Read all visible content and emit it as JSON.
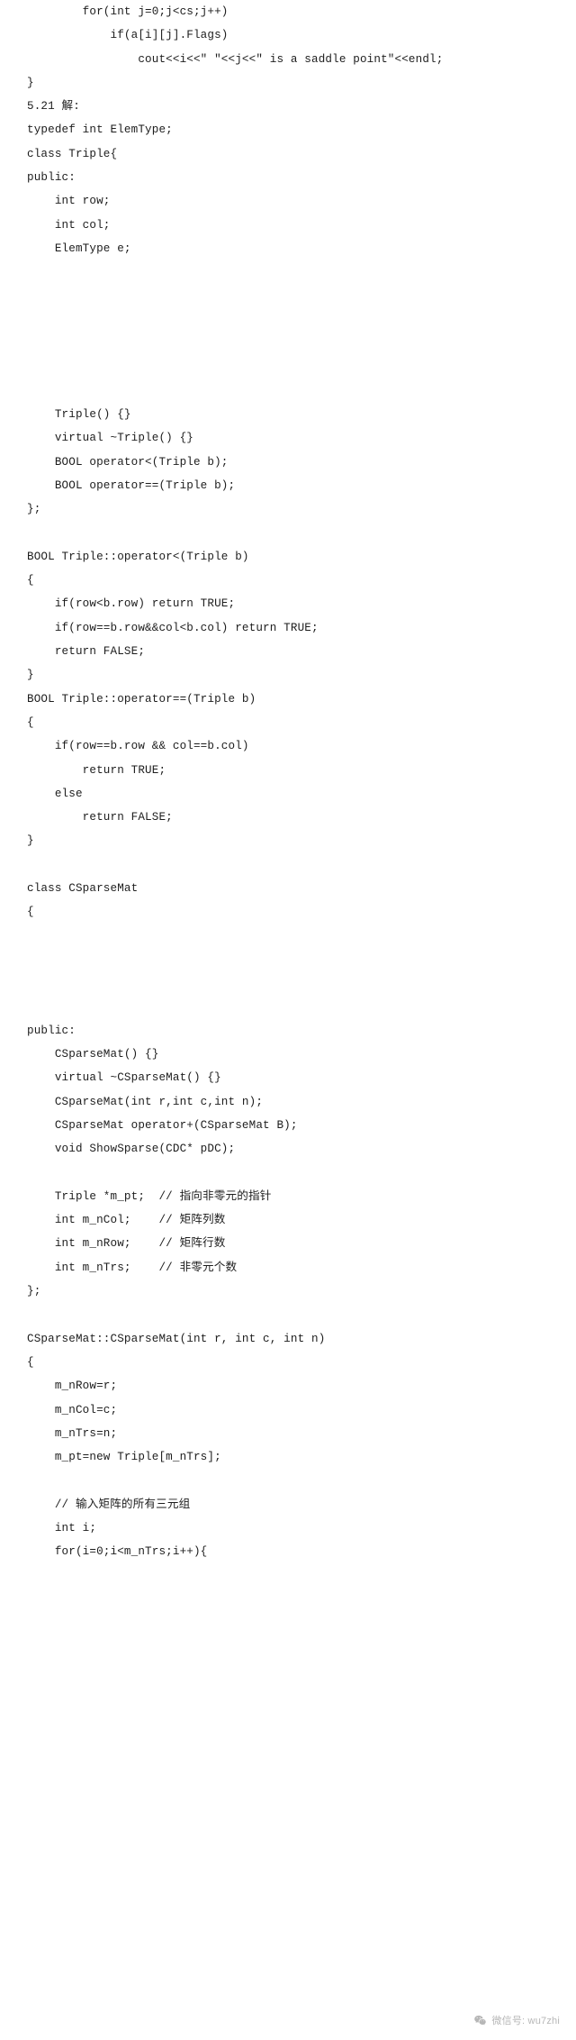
{
  "document": {
    "type": "scanned-textbook-page",
    "language": "cpp",
    "section_label": "5.21 解:",
    "code_lines": [
      "        for(int j=0;j<cs;j++)",
      "            if(a[i][j].Flags)",
      "                cout<<i<<\" \"<<j<<\" is a saddle point\"<<endl;",
      "}",
      "5.21 解:",
      "typedef int ElemType;",
      "class Triple{",
      "public:",
      "    int row;",
      "    int col;",
      "    ElemType e;",
      "",
      "",
      "",
      "",
      "",
      "",
      "    Triple() {}",
      "    virtual ~Triple() {}",
      "    BOOL operator<(Triple b);",
      "    BOOL operator==(Triple b);",
      "};",
      "",
      "BOOL Triple::operator<(Triple b)",
      "{",
      "    if(row<b.row) return TRUE;",
      "    if(row==b.row&&col<b.col) return TRUE;",
      "    return FALSE;",
      "}",
      "BOOL Triple::operator==(Triple b)",
      "{",
      "    if(row==b.row && col==b.col)",
      "        return TRUE;",
      "    else",
      "        return FALSE;",
      "}",
      "",
      "class CSparseMat",
      "{",
      "",
      "",
      "",
      "",
      "public:",
      "    CSparseMat() {}",
      "    virtual ~CSparseMat() {}",
      "    CSparseMat(int r,int c,int n);",
      "    CSparseMat operator+(CSparseMat B);",
      "    void ShowSparse(CDC* pDC);",
      "",
      "    Triple *m_pt;  // 指向非零元的指针",
      "    int m_nCol;    // 矩阵列数",
      "    int m_nRow;    // 矩阵行数",
      "    int m_nTrs;    // 非零元个数",
      "};",
      "",
      "CSparseMat::CSparseMat(int r, int c, int n)",
      "{",
      "    m_nRow=r;",
      "    m_nCol=c;",
      "    m_nTrs=n;",
      "    m_pt=new Triple[m_nTrs];",
      "",
      "    // 输入矩阵的所有三元组",
      "    int i;",
      "    for(i=0;i<m_nTrs;i++){"
    ]
  },
  "footer": {
    "watermark_text": "微信号: wu7zhi",
    "icon": "wechat-icon",
    "icon_color": "#8a8a8a"
  },
  "colors": {
    "page_background": "#ffffff",
    "text": "#1f1f1f",
    "watermark": "#8a8a8a"
  }
}
